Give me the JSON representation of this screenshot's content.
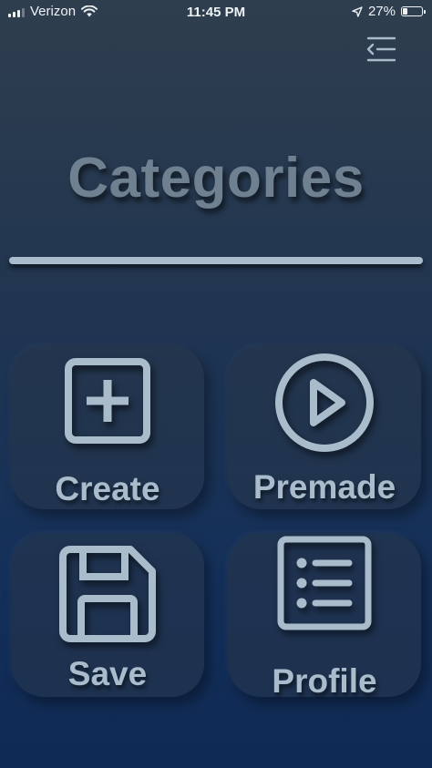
{
  "status_bar": {
    "carrier": "Verizon",
    "time": "11:45 PM",
    "battery_percent": "27%",
    "battery_level": 0.27,
    "icons": [
      "signal-icon",
      "wifi-icon",
      "location-arrow-icon",
      "battery-icon"
    ]
  },
  "header": {
    "menu_icon": "menu-collapse-icon",
    "title": "Categories"
  },
  "tiles": [
    {
      "label": "Create",
      "icon": "plus-square-icon"
    },
    {
      "label": "Premade",
      "icon": "play-circle-icon"
    },
    {
      "label": "Save",
      "icon": "floppy-disk-icon"
    },
    {
      "label": "Profile",
      "icon": "list-icon"
    }
  ],
  "colors": {
    "accent": "#a9bccb",
    "title": "#6f8191",
    "background_top": "#2f3e4e",
    "background_bottom": "#0f2a55",
    "tile_background": "#2a3a4f"
  }
}
